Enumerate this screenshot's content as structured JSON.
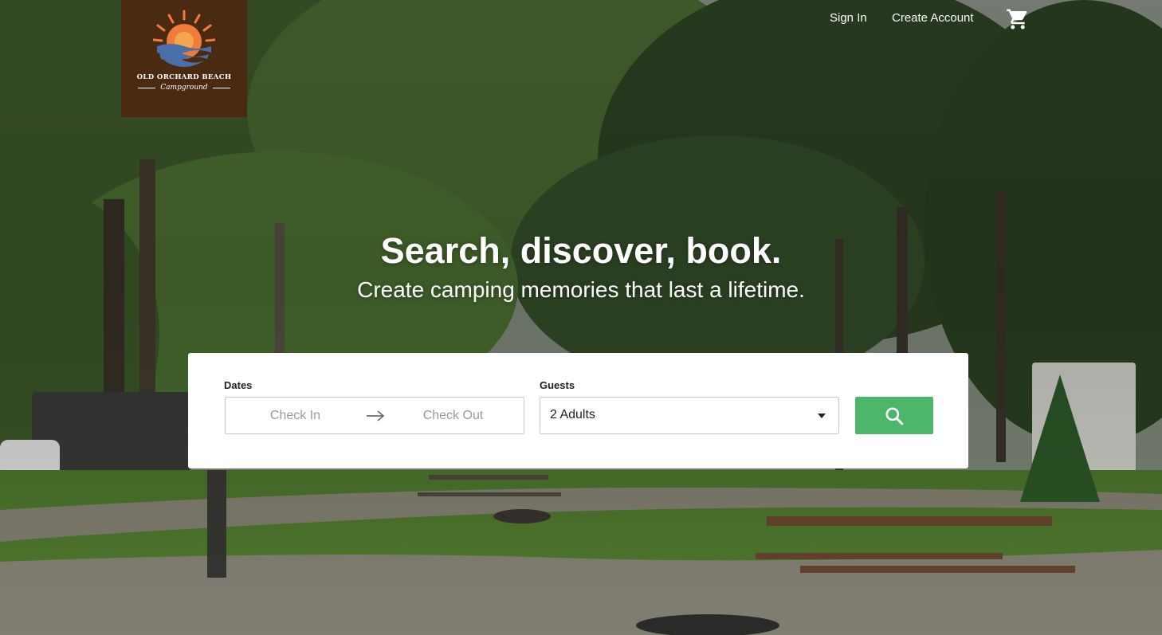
{
  "brand": {
    "name_line1": "OLD ORCHARD BEACH",
    "name_line2": "Campground",
    "logo_bg": "#4a2a10",
    "sun_color": "#f07b3a",
    "wave_color": "#4a6fa8"
  },
  "nav": {
    "sign_in": "Sign In",
    "create_account": "Create Account",
    "cart_icon": "shopping-cart-icon"
  },
  "hero": {
    "headline": "Search, discover, book.",
    "subheadline": "Create camping memories that last a lifetime."
  },
  "search": {
    "dates_label": "Dates",
    "check_in_placeholder": "Check In",
    "check_out_placeholder": "Check Out",
    "arrow_icon": "arrow-right-icon",
    "guests_label": "Guests",
    "guests_value": "2 Adults",
    "dropdown_icon": "caret-down-icon",
    "search_icon": "magnifier-icon",
    "button_color": "#4cb66a"
  }
}
